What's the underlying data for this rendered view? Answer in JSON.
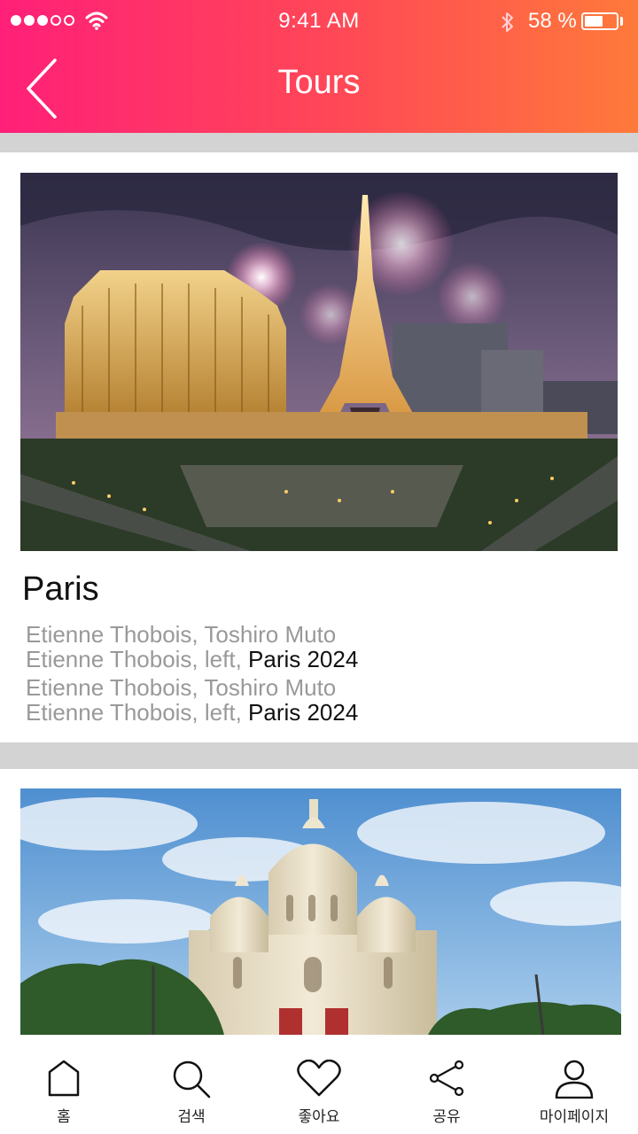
{
  "status_bar": {
    "time": "9:41 AM",
    "battery_text": "58 %",
    "battery_level": 0.58,
    "signal_bars_filled": 3,
    "signal_bars_total": 5
  },
  "header": {
    "title": "Tours",
    "back_icon": "chevron-left-icon",
    "gradient": [
      "#ff1f78",
      "#ff7a3a"
    ]
  },
  "cards": [
    {
      "title": "Paris",
      "image": "paris-las-vegas-eiffel-fireworks",
      "lines": [
        {
          "muted": "Etienne Thobois, Toshiro Muto",
          "highlight": ""
        },
        {
          "muted": "Etienne Thobois, left, ",
          "highlight": "Paris 2024"
        },
        {
          "muted": "Etienne Thobois, Toshiro Muto",
          "highlight": ""
        },
        {
          "muted": "Etienne Thobois, left, ",
          "highlight": "Paris 2024"
        }
      ]
    },
    {
      "title": "",
      "image": "sacre-coeur-basilica"
    }
  ],
  "tabbar": {
    "items": [
      {
        "label": "홈",
        "icon": "home-icon"
      },
      {
        "label": "검색",
        "icon": "search-icon"
      },
      {
        "label": "좋아요",
        "icon": "heart-icon"
      },
      {
        "label": "공유",
        "icon": "share-icon"
      },
      {
        "label": "마이페이지",
        "icon": "person-icon"
      }
    ]
  }
}
